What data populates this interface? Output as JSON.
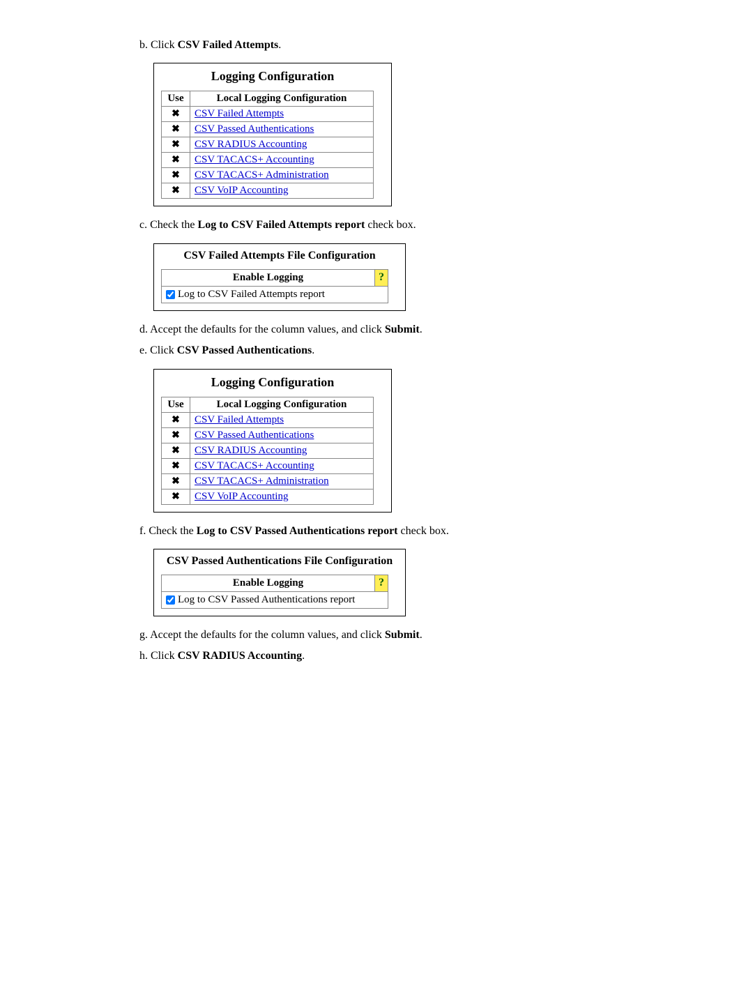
{
  "steps": {
    "b": {
      "prefix": "b. Click ",
      "bold": "CSV Failed Attempts",
      "suffix": "."
    },
    "c": {
      "prefix": "c. Check the ",
      "bold": "Log to CSV Failed Attempts report",
      "suffix": " check box."
    },
    "d": {
      "prefix": "d. Accept the defaults for the column values, and click ",
      "bold": "Submit",
      "suffix": "."
    },
    "e": {
      "prefix": "e. Click ",
      "bold": "CSV Passed Authentications",
      "suffix": "."
    },
    "f": {
      "prefix": "f. Check the ",
      "bold": "Log to CSV Passed Authentications report",
      "suffix": " check box."
    },
    "g": {
      "prefix": "g. Accept the defaults for the column values, and click ",
      "bold": "Submit",
      "suffix": "."
    },
    "h": {
      "prefix": "h. Click ",
      "bold": "CSV RADIUS Accounting",
      "suffix": "."
    }
  },
  "logging_config": {
    "title": "Logging Configuration",
    "col_use": "Use",
    "col_name": "Local Logging Configuration",
    "x": "✖",
    "rows": [
      "CSV Failed Attempts",
      "CSV Passed Authentications",
      "CSV RADIUS Accounting",
      "CSV TACACS+ Accounting",
      "CSV TACACS+ Administration",
      "CSV VoIP Accounting"
    ]
  },
  "failed_box": {
    "title": "CSV Failed Attempts File Configuration",
    "enable_label": "Enable Logging",
    "checkbox_label": "Log to CSV Failed Attempts report",
    "help": "?"
  },
  "passed_box": {
    "title": "CSV Passed Authentications File Configuration",
    "enable_label": "Enable Logging",
    "checkbox_label": "Log to CSV Passed Authentications report",
    "help": "?"
  }
}
